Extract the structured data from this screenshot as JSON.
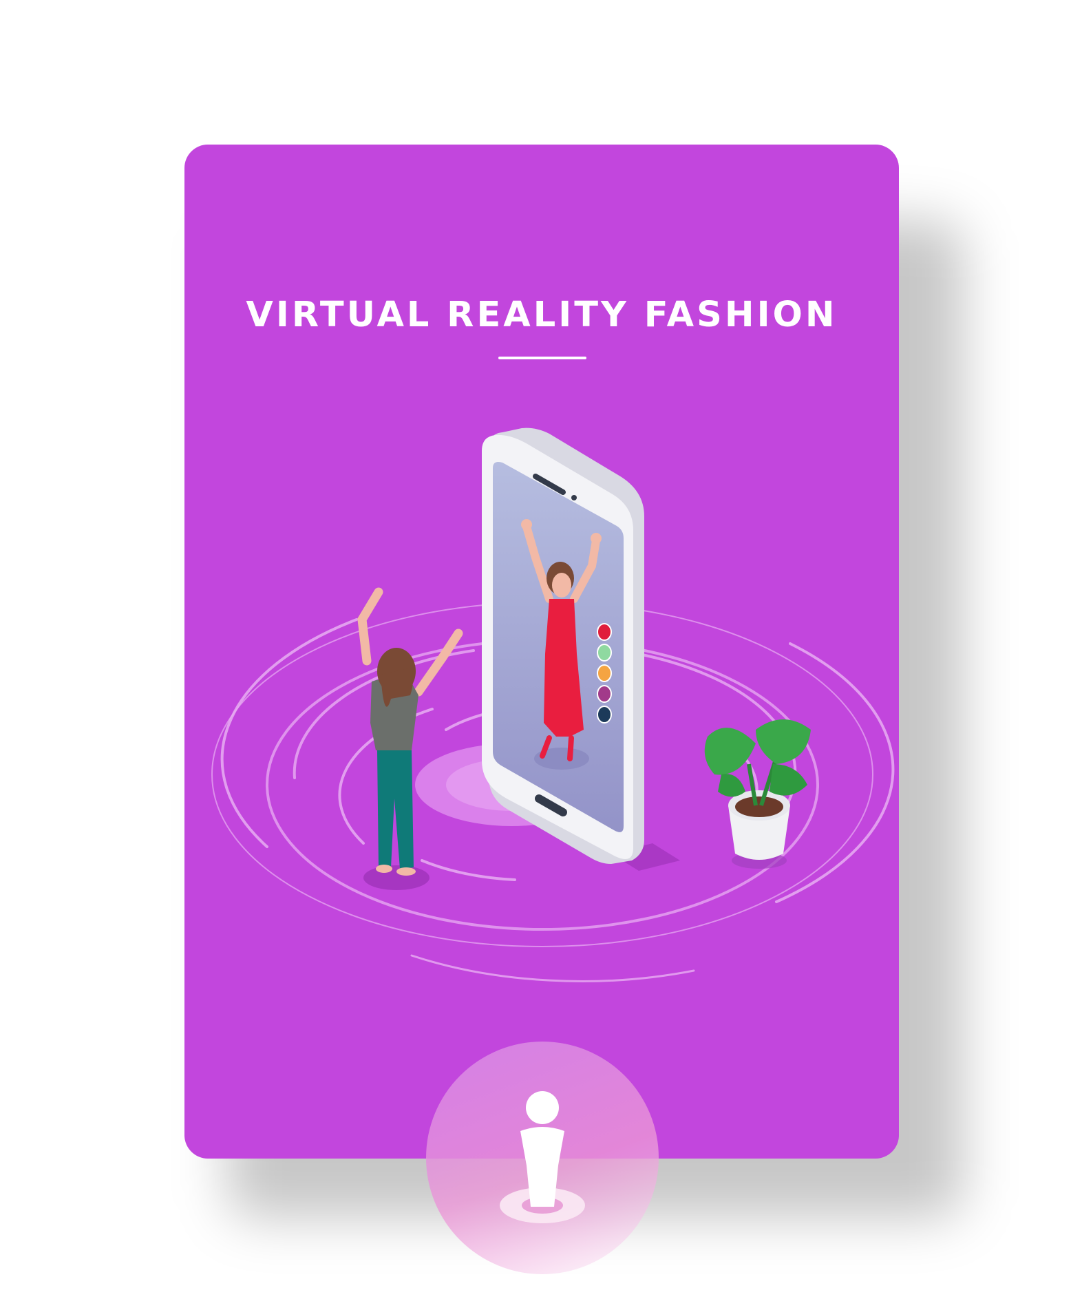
{
  "card": {
    "title": "VIRTUAL REALITY FASHION",
    "background_color": "#c246dd"
  },
  "illustration": {
    "screen_dress_color": "#e91e3f",
    "swatch_colors": [
      "#e01d3b",
      "#8fd9a0",
      "#f5a442",
      "#a23a8a",
      "#1c3a5a"
    ],
    "plant_leaf_color": "#3aa84a"
  },
  "badge": {
    "icon": "person-on-pad-icon"
  }
}
